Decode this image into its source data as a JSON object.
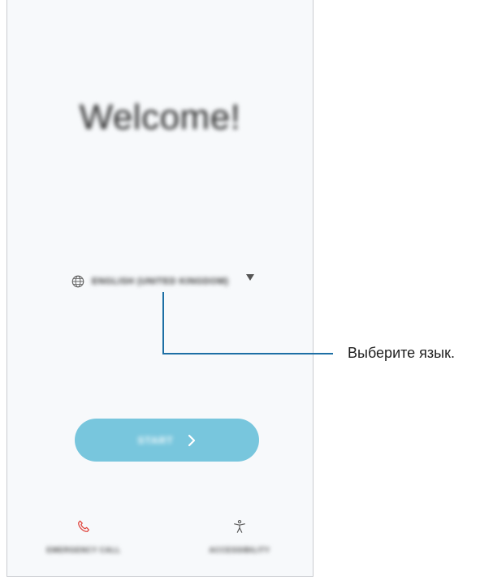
{
  "screen": {
    "welcome_title": "Welcome!",
    "language": {
      "selected": "ENGLISH (UNITED KINGDOM)",
      "icon": "globe-icon"
    },
    "start_button": {
      "label": "START",
      "icon": "chevron-right-icon"
    },
    "emergency_call": {
      "label": "EMERGENCY CALL",
      "icon": "phone-icon",
      "icon_color": "#e0443c"
    },
    "accessibility": {
      "label": "ACCESSIBILITY",
      "icon": "accessibility-icon"
    }
  },
  "callout": {
    "text": "Выберите язык.",
    "color": "#1d6fa5"
  },
  "colors": {
    "start_button_bg": "#78c6dd"
  }
}
